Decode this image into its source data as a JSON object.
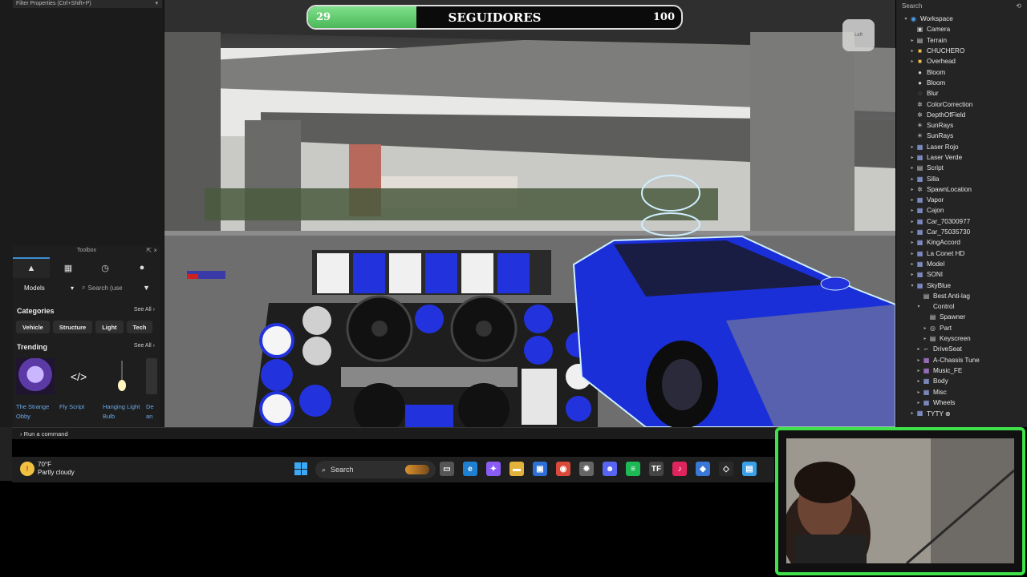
{
  "properties": {
    "filter_placeholder": "Filter Properties (Ctrl+Shift+P)"
  },
  "toolbox": {
    "title": "Toolbox",
    "models_label": "Models",
    "search_placeholder": "Search (use",
    "categories_label": "Categories",
    "see_all": "See All",
    "categories": [
      "Vehicle",
      "Structure",
      "Light",
      "Tech"
    ],
    "trending_label": "Trending",
    "trending": [
      {
        "label": "The Strange Obby",
        "icon": "smiley-icon"
      },
      {
        "label": "Fly Script",
        "icon": "code-icon"
      },
      {
        "label": "Hanging Light Bulb",
        "icon": "bulb-icon"
      },
      {
        "label": "De an",
        "icon": "model-icon"
      }
    ]
  },
  "overlay": {
    "followers_current": "29",
    "followers_title": "SEGUIDORES",
    "followers_goal": "100",
    "progress": 0.29
  },
  "viewcube_label": "Left",
  "explorer": {
    "search_label": "Search",
    "items": [
      {
        "label": "Workspace",
        "indent": 0,
        "arrow": "▾",
        "icon": "◉",
        "color": "#4aa3ff"
      },
      {
        "label": "Camera",
        "indent": 1,
        "arrow": "",
        "icon": "▣",
        "color": "#cfcfcf"
      },
      {
        "label": "Terrain",
        "indent": 1,
        "arrow": "▸",
        "icon": "▤",
        "color": "#cfcfcf"
      },
      {
        "label": "CHUCHERO",
        "indent": 1,
        "arrow": "▸",
        "icon": "■",
        "color": "#f2c14e"
      },
      {
        "label": "Overhead",
        "indent": 1,
        "arrow": "▸",
        "icon": "■",
        "color": "#f2c14e"
      },
      {
        "label": "Bloom",
        "indent": 1,
        "arrow": "",
        "icon": "●",
        "color": "#cfcfcf"
      },
      {
        "label": "Bloom",
        "indent": 1,
        "arrow": "",
        "icon": "●",
        "color": "#cfcfcf"
      },
      {
        "label": "Blur",
        "indent": 1,
        "arrow": "",
        "icon": "◌",
        "color": "#cfcfcf"
      },
      {
        "label": "ColorCorrection",
        "indent": 1,
        "arrow": "",
        "icon": "✲",
        "color": "#cfcfcf"
      },
      {
        "label": "DepthOfField",
        "indent": 1,
        "arrow": "",
        "icon": "✲",
        "color": "#cfcfcf"
      },
      {
        "label": "SunRays",
        "indent": 1,
        "arrow": "",
        "icon": "☀",
        "color": "#cfcfcf"
      },
      {
        "label": "SunRays",
        "indent": 1,
        "arrow": "",
        "icon": "☀",
        "color": "#cfcfcf"
      },
      {
        "label": "Laser Rojo",
        "indent": 1,
        "arrow": "▸",
        "icon": "▦",
        "color": "#9fb4ff"
      },
      {
        "label": "Laser Verde",
        "indent": 1,
        "arrow": "▸",
        "icon": "▦",
        "color": "#9fb4ff"
      },
      {
        "label": "Script",
        "indent": 1,
        "arrow": "▸",
        "icon": "▤",
        "color": "#cfcfcf"
      },
      {
        "label": "Silla",
        "indent": 1,
        "arrow": "▸",
        "icon": "▦",
        "color": "#9fb4ff"
      },
      {
        "label": "SpawnLocation",
        "indent": 1,
        "arrow": "▸",
        "icon": "✲",
        "color": "#cfcfcf"
      },
      {
        "label": "Vapor",
        "indent": 1,
        "arrow": "▸",
        "icon": "▦",
        "color": "#9fb4ff"
      },
      {
        "label": "Cajon",
        "indent": 1,
        "arrow": "▸",
        "icon": "▦",
        "color": "#9fb4ff"
      },
      {
        "label": "Car_70300977",
        "indent": 1,
        "arrow": "▸",
        "icon": "▦",
        "color": "#9fb4ff"
      },
      {
        "label": "Car_75035730",
        "indent": 1,
        "arrow": "▸",
        "icon": "▦",
        "color": "#9fb4ff"
      },
      {
        "label": "KingAccord",
        "indent": 1,
        "arrow": "▸",
        "icon": "▦",
        "color": "#9fb4ff"
      },
      {
        "label": "La Conet HD",
        "indent": 1,
        "arrow": "▸",
        "icon": "▦",
        "color": "#9fb4ff"
      },
      {
        "label": "Model",
        "indent": 1,
        "arrow": "▸",
        "icon": "▦",
        "color": "#9fb4ff"
      },
      {
        "label": "SONI",
        "indent": 1,
        "arrow": "▸",
        "icon": "▦",
        "color": "#9fb4ff"
      },
      {
        "label": "SkyBlue",
        "indent": 1,
        "arrow": "▾",
        "icon": "▦",
        "color": "#9fb4ff"
      },
      {
        "label": "Best Anti-lag",
        "indent": 2,
        "arrow": "",
        "icon": "▤",
        "color": "#cfcfcf"
      },
      {
        "label": "Control",
        "indent": 2,
        "arrow": "▾",
        "icon": "",
        "color": "#cfcfcf"
      },
      {
        "label": "Spawner",
        "indent": 3,
        "arrow": "",
        "icon": "▤",
        "color": "#cfcfcf"
      },
      {
        "label": "Part",
        "indent": 3,
        "arrow": "▸",
        "icon": "◎",
        "color": "#cfcfcf"
      },
      {
        "label": "Keyscreen",
        "indent": 3,
        "arrow": "▸",
        "icon": "▤",
        "color": "#cfcfcf"
      },
      {
        "label": "DriveSeat",
        "indent": 2,
        "arrow": "▸",
        "icon": "⌐",
        "color": "#cfcfcf"
      },
      {
        "label": "A-Chassis Tune",
        "indent": 2,
        "arrow": "▸",
        "icon": "▦",
        "color": "#c88cff"
      },
      {
        "label": "Music_FE",
        "indent": 2,
        "arrow": "▸",
        "icon": "▦",
        "color": "#c88cff"
      },
      {
        "label": "Body",
        "indent": 2,
        "arrow": "▸",
        "icon": "▦",
        "color": "#9fb4ff"
      },
      {
        "label": "Misc",
        "indent": 2,
        "arrow": "▸",
        "icon": "▦",
        "color": "#9fb4ff"
      },
      {
        "label": "Wheels",
        "indent": 2,
        "arrow": "▸",
        "icon": "▦",
        "color": "#9fb4ff"
      },
      {
        "label": "TYTY ⊕",
        "indent": 1,
        "arrow": "▸",
        "icon": "▦",
        "color": "#9fb4ff"
      }
    ]
  },
  "command_bar": {
    "placeholder": "Run a command"
  },
  "taskbar": {
    "weather_temp": "70°F",
    "weather_desc": "Partly cloudy",
    "search_label": "Search",
    "apps": [
      {
        "name": "task-view-icon",
        "glyph": "▭",
        "color": "#555"
      },
      {
        "name": "edge-icon",
        "glyph": "e",
        "color": "#1f7fd0"
      },
      {
        "name": "copilot-icon",
        "glyph": "✦",
        "color": "#8a5cf6"
      },
      {
        "name": "file-explorer-icon",
        "glyph": "▬",
        "color": "#e2b23a"
      },
      {
        "name": "store-icon",
        "glyph": "▣",
        "color": "#2d6fd6"
      },
      {
        "name": "chrome-icon",
        "glyph": "◉",
        "color": "#d94a3a"
      },
      {
        "name": "settings-icon",
        "glyph": "✹",
        "color": "#666"
      },
      {
        "name": "discord-icon",
        "glyph": "☻",
        "color": "#5865f2"
      },
      {
        "name": "spotify-icon",
        "glyph": "≡",
        "color": "#1db954"
      },
      {
        "name": "tf-icon",
        "glyph": "TF",
        "color": "#444"
      },
      {
        "name": "tiktok-icon",
        "glyph": "♪",
        "color": "#e0245e"
      },
      {
        "name": "roblox-icon",
        "glyph": "◆",
        "color": "#3a78d8"
      },
      {
        "name": "roblox-studio-icon",
        "glyph": "◇",
        "color": "#2a2a2a"
      },
      {
        "name": "notepad-icon",
        "glyph": "▤",
        "color": "#3aa0e8"
      }
    ]
  },
  "colors": {
    "accent": "#3b8fd6",
    "webcam_frame": "#3fe24a",
    "car_blue": "#1a2fd8",
    "progress_green": "#5fcf6d"
  }
}
